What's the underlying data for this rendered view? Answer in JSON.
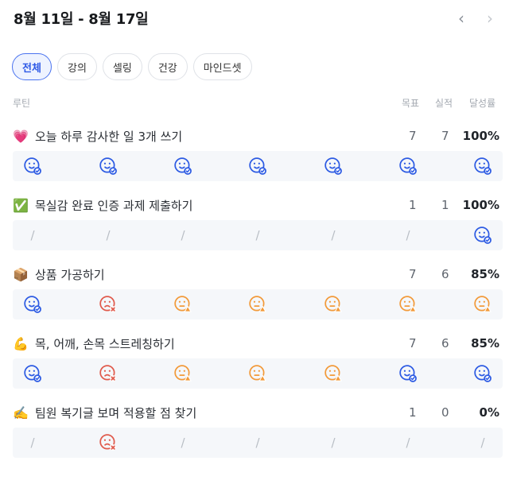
{
  "header": {
    "title": "8월 11일 - 8월 17일",
    "prev_icon": "chevron-left-icon",
    "next_icon": "chevron-right-icon"
  },
  "filters": [
    {
      "label": "전체",
      "active": true
    },
    {
      "label": "강의",
      "active": false
    },
    {
      "label": "셀링",
      "active": false
    },
    {
      "label": "건강",
      "active": false
    },
    {
      "label": "마인드셋",
      "active": false
    }
  ],
  "columns": {
    "routine": "루틴",
    "goal": "목표",
    "actual": "실적",
    "rate": "달성률"
  },
  "colors": {
    "done": "#2d5be3",
    "failed": "#e05a4c",
    "partial": "#f29a3a",
    "none": "#b8bdc4",
    "accent": "#2d59e6"
  },
  "routines": [
    {
      "emoji": "💗",
      "emoji_icon": "heart-icon",
      "title": "오늘 하루 감사한 일 3개 쓰기",
      "goal": "7",
      "actual": "7",
      "rate": "100%",
      "days": [
        {
          "status": "done",
          "label": ""
        },
        {
          "status": "done",
          "label": ""
        },
        {
          "status": "done",
          "label": ""
        },
        {
          "status": "done",
          "label": ""
        },
        {
          "status": "done",
          "label": ""
        },
        {
          "status": "done",
          "label": ""
        },
        {
          "status": "done",
          "label": ""
        }
      ]
    },
    {
      "emoji": "✅",
      "emoji_icon": "check-mark-icon",
      "title": "목실감 완료 인증 과제 제출하기",
      "goal": "1",
      "actual": "1",
      "rate": "100%",
      "days": [
        {
          "status": "none",
          "label": "/"
        },
        {
          "status": "none",
          "label": "/"
        },
        {
          "status": "none",
          "label": "/"
        },
        {
          "status": "none",
          "label": "/"
        },
        {
          "status": "none",
          "label": "/"
        },
        {
          "status": "none",
          "label": "/"
        },
        {
          "status": "done",
          "label": ""
        }
      ]
    },
    {
      "emoji": "📦",
      "emoji_icon": "package-icon",
      "title": "상품 가공하기",
      "goal": "7",
      "actual": "6",
      "rate": "85%",
      "days": [
        {
          "status": "done",
          "label": ""
        },
        {
          "status": "failed",
          "label": ""
        },
        {
          "status": "partial",
          "label": ""
        },
        {
          "status": "partial",
          "label": ""
        },
        {
          "status": "partial",
          "label": ""
        },
        {
          "status": "partial",
          "label": ""
        },
        {
          "status": "partial",
          "label": ""
        }
      ]
    },
    {
      "emoji": "💪",
      "emoji_icon": "flexed-arm-icon",
      "title": "목, 어깨, 손목 스트레칭하기",
      "goal": "7",
      "actual": "6",
      "rate": "85%",
      "days": [
        {
          "status": "done",
          "label": ""
        },
        {
          "status": "failed",
          "label": ""
        },
        {
          "status": "partial",
          "label": ""
        },
        {
          "status": "partial",
          "label": ""
        },
        {
          "status": "partial",
          "label": ""
        },
        {
          "status": "done",
          "label": ""
        },
        {
          "status": "done",
          "label": ""
        }
      ]
    },
    {
      "emoji": "✍️",
      "emoji_icon": "writing-hand-icon",
      "title": "팀원 복기글 보며 적용할 점 찾기",
      "goal": "1",
      "actual": "0",
      "rate": "0%",
      "days": [
        {
          "status": "none",
          "label": "/"
        },
        {
          "status": "failed",
          "label": ""
        },
        {
          "status": "none",
          "label": "/"
        },
        {
          "status": "none",
          "label": "/"
        },
        {
          "status": "none",
          "label": "/"
        },
        {
          "status": "none",
          "label": "/"
        },
        {
          "status": "none",
          "label": "/"
        }
      ]
    }
  ]
}
